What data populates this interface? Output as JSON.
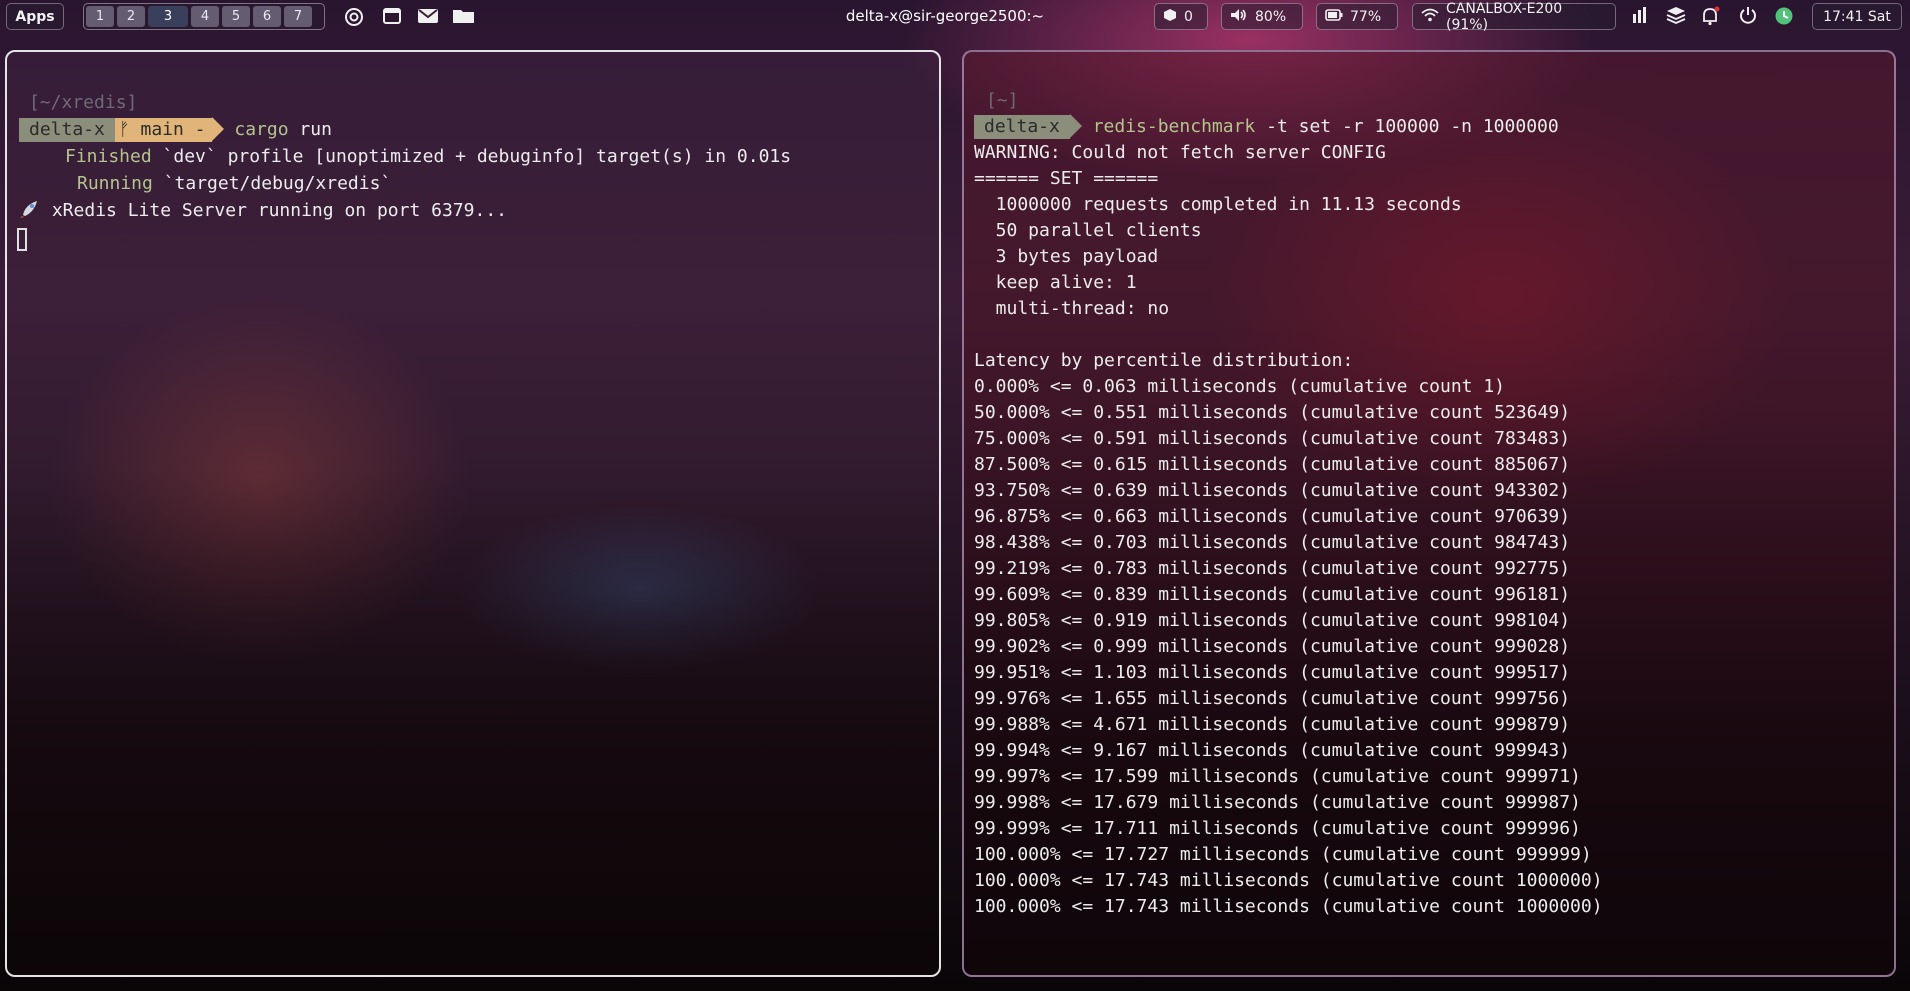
{
  "topbar": {
    "apps_label": "Apps",
    "workspaces": [
      "1",
      "2",
      "3",
      "4",
      "5",
      "6",
      "7"
    ],
    "active_workspace": "3",
    "window_title": "delta-x@sir-george2500:~",
    "updates": "0",
    "volume": "80%",
    "battery": "77%",
    "wifi": "CANALBOX-E200 (91%)",
    "clock": "17:41 Sat"
  },
  "left_terminal": {
    "cwd": "[~/xredis]",
    "host": "delta-x",
    "git_branch": "main -",
    "command": "cargo",
    "command_args": "run",
    "finished_label": "Finished",
    "finished_text": "`dev` profile [unoptimized + debuginfo] target(s) in 0.01s",
    "running_label": "Running",
    "running_text": "`target/debug/xredis`",
    "server_line": "xRedis Lite Server running on port 6379..."
  },
  "right_terminal": {
    "cwd": "[~]",
    "host": "delta-x",
    "command": "redis-benchmark",
    "command_args": "-t set -r 100000 -n 1000000",
    "output": [
      "WARNING: Could not fetch server CONFIG",
      "====== SET ======",
      "  1000000 requests completed in 11.13 seconds",
      "  50 parallel clients",
      "  3 bytes payload",
      "  keep alive: 1",
      "  multi-thread: no",
      "",
      "Latency by percentile distribution:",
      "0.000% <= 0.063 milliseconds (cumulative count 1)",
      "50.000% <= 0.551 milliseconds (cumulative count 523649)",
      "75.000% <= 0.591 milliseconds (cumulative count 783483)",
      "87.500% <= 0.615 milliseconds (cumulative count 885067)",
      "93.750% <= 0.639 milliseconds (cumulative count 943302)",
      "96.875% <= 0.663 milliseconds (cumulative count 970639)",
      "98.438% <= 0.703 milliseconds (cumulative count 984743)",
      "99.219% <= 0.783 milliseconds (cumulative count 992775)",
      "99.609% <= 0.839 milliseconds (cumulative count 996181)",
      "99.805% <= 0.919 milliseconds (cumulative count 998104)",
      "99.902% <= 0.999 milliseconds (cumulative count 999028)",
      "99.951% <= 1.103 milliseconds (cumulative count 999517)",
      "99.976% <= 1.655 milliseconds (cumulative count 999756)",
      "99.988% <= 4.671 milliseconds (cumulative count 999879)",
      "99.994% <= 9.167 milliseconds (cumulative count 999943)",
      "99.997% <= 17.599 milliseconds (cumulative count 999971)",
      "99.998% <= 17.679 milliseconds (cumulative count 999987)",
      "99.999% <= 17.711 milliseconds (cumulative count 999996)",
      "100.000% <= 17.727 milliseconds (cumulative count 999999)",
      "100.000% <= 17.743 milliseconds (cumulative count 1000000)",
      "100.000% <= 17.743 milliseconds (cumulative count 1000000)"
    ]
  },
  "icons": {
    "openai": "openai-icon",
    "window": "window-icon",
    "mail": "mail-icon",
    "folder": "folder-icon",
    "package": "package-icon",
    "volume": "volume-icon",
    "battery": "battery-icon",
    "wifi": "wifi-icon",
    "stats": "stats-icon",
    "layers": "layers-icon",
    "bell": "bell-icon",
    "power": "power-icon",
    "status": "status-icon"
  }
}
